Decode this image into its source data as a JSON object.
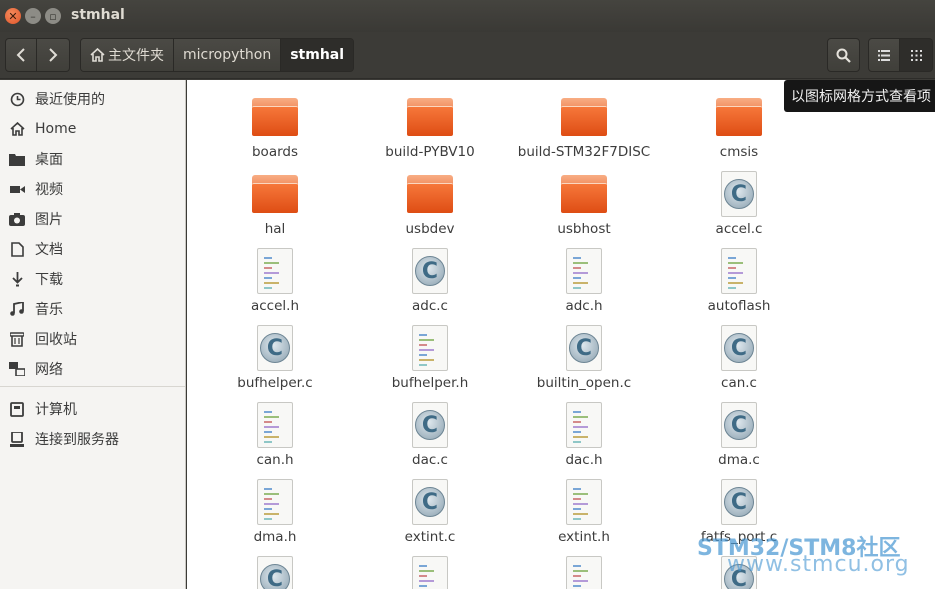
{
  "window": {
    "title": "stmhal"
  },
  "toolbar": {
    "breadcrumbs": [
      "主文件夹",
      "micropython",
      "stmhal"
    ],
    "tooltip": "以图标网格方式查看项"
  },
  "sidebar": {
    "items": [
      {
        "label": "最近使用的",
        "icon": "clock-icon"
      },
      {
        "label": "Home",
        "icon": "home-icon"
      },
      {
        "label": "桌面",
        "icon": "desktop-folder-icon"
      },
      {
        "label": "视频",
        "icon": "video-icon"
      },
      {
        "label": "图片",
        "icon": "camera-icon"
      },
      {
        "label": "文档",
        "icon": "document-icon"
      },
      {
        "label": "下载",
        "icon": "download-icon"
      },
      {
        "label": "音乐",
        "icon": "music-icon"
      },
      {
        "label": "回收站",
        "icon": "trash-icon"
      },
      {
        "label": "网络",
        "icon": "network-icon"
      },
      {
        "label": "计算机",
        "icon": "computer-icon"
      },
      {
        "label": "连接到服务器",
        "icon": "server-icon"
      }
    ]
  },
  "files": [
    {
      "name": "boards",
      "type": "folder"
    },
    {
      "name": "build-PYBV10",
      "type": "folder"
    },
    {
      "name": "build-STM32F7DISC",
      "type": "folder"
    },
    {
      "name": "cmsis",
      "type": "folder"
    },
    {
      "name": "hal",
      "type": "folder"
    },
    {
      "name": "usbdev",
      "type": "folder"
    },
    {
      "name": "usbhost",
      "type": "folder"
    },
    {
      "name": "accel.c",
      "type": "c"
    },
    {
      "name": "accel.h",
      "type": "h"
    },
    {
      "name": "adc.c",
      "type": "c"
    },
    {
      "name": "adc.h",
      "type": "h"
    },
    {
      "name": "autoflash",
      "type": "h"
    },
    {
      "name": "bufhelper.c",
      "type": "c"
    },
    {
      "name": "bufhelper.h",
      "type": "h"
    },
    {
      "name": "builtin_open.c",
      "type": "c"
    },
    {
      "name": "can.c",
      "type": "c"
    },
    {
      "name": "can.h",
      "type": "h"
    },
    {
      "name": "dac.c",
      "type": "c"
    },
    {
      "name": "dac.h",
      "type": "h"
    },
    {
      "name": "dma.c",
      "type": "c"
    },
    {
      "name": "dma.h",
      "type": "h"
    },
    {
      "name": "extint.c",
      "type": "c"
    },
    {
      "name": "extint.h",
      "type": "h"
    },
    {
      "name": "fatfs_port.c",
      "type": "c"
    },
    {
      "name": "",
      "type": "c"
    },
    {
      "name": "",
      "type": "h"
    },
    {
      "name": "",
      "type": "h"
    },
    {
      "name": "",
      "type": "c"
    }
  ],
  "watermark": {
    "line1": "STM32/STM8社区",
    "line2": "www.stmcu.org"
  }
}
